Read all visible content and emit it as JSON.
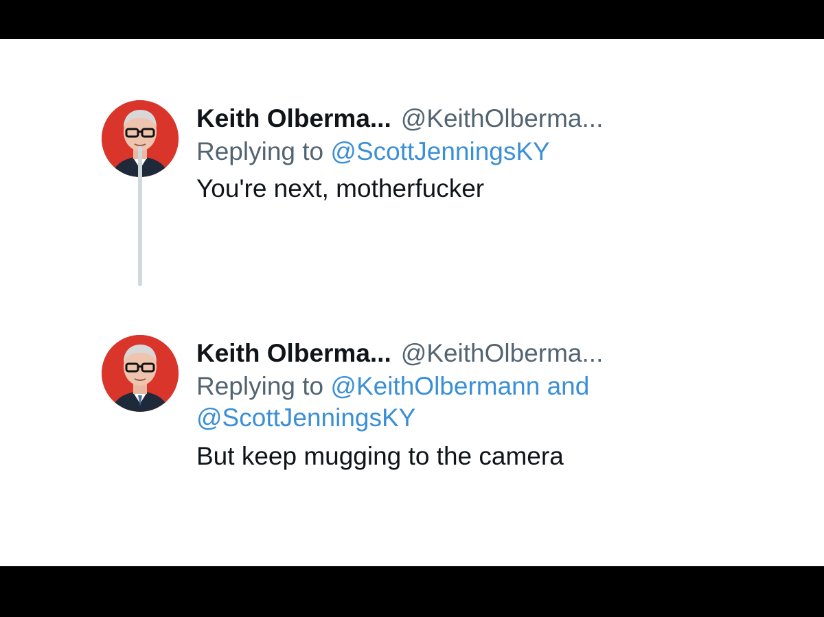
{
  "thread": {
    "tweets": [
      {
        "display_name": "Keith Olberma...",
        "handle": "@KeithOlberma...",
        "replying_prefix": "Replying to",
        "replying_line1": "@ScottJenningsKY",
        "replying_line2": "",
        "body": "You're next, motherfucker"
      },
      {
        "display_name": "Keith Olberma...",
        "handle": "@KeithOlberma...",
        "replying_prefix": "Replying to",
        "replying_line1": "@KeithOlbermann and",
        "replying_line2": "@ScottJenningsKY",
        "body": "But keep mugging to the camera"
      }
    ]
  },
  "colors": {
    "avatar_background": "#d9352b",
    "mention": "#3a8fd6",
    "secondary_text": "#536471",
    "primary_text": "#0f1419",
    "thread_line": "#cfd9de"
  },
  "icons": {
    "avatar": "profile-photo"
  }
}
